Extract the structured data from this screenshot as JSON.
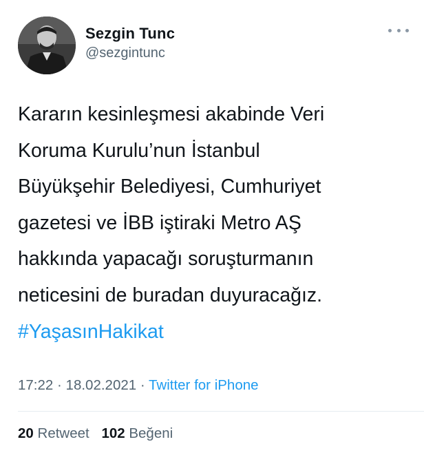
{
  "author": {
    "display_name": "Sezgin Tunc",
    "handle": "@sezgintunc"
  },
  "tweet": {
    "lines": [
      "Kararın kesinleşmesi akabinde Veri",
      "Koruma Kurulu’nun İstanbul",
      "Büyükşehir Belediyesi, Cumhuriyet",
      "gazetesi ve İBB iştiraki Metro AŞ",
      "hakkında yapacağı soruşturmanın",
      "neticesini de buradan duyuracağız."
    ],
    "hashtag": "#YaşasınHakikat"
  },
  "meta": {
    "time": "17:22",
    "separator": "·",
    "date": "18.02.2021",
    "source": "Twitter for iPhone"
  },
  "stats": {
    "retweets_count": "20",
    "retweets_label": "Retweet",
    "likes_count": "102",
    "likes_label": "Beğeni"
  },
  "icons": {
    "more": "more-options-icon"
  },
  "colors": {
    "link": "#1d9bf0",
    "secondary_text": "#536471",
    "primary_text": "#0f1419"
  }
}
